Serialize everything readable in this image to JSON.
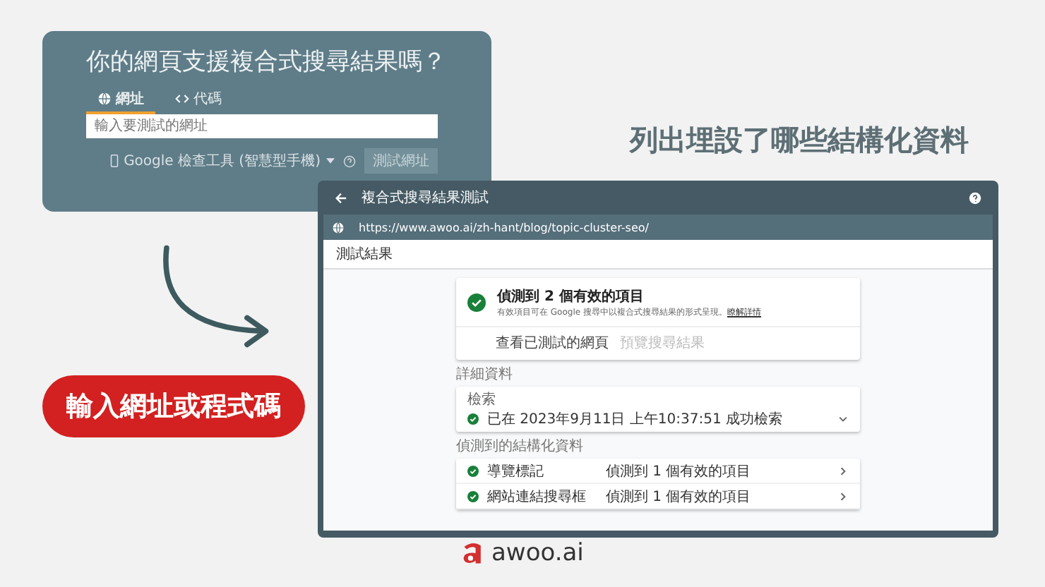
{
  "search_card": {
    "title": "你的網頁支援複合式搜尋結果嗎？",
    "tabs": [
      {
        "label": "網址",
        "kind": "url",
        "selected": true
      },
      {
        "label": "代碼",
        "kind": "code",
        "selected": false
      }
    ],
    "url_field": {
      "placeholder": "輸入要測試的網址"
    },
    "device_select": "Google 檢查工具 (智慧型手機)",
    "test_button": "測試網址"
  },
  "heading": "列出埋設了哪些結構化資料",
  "callout": "輸入網址或程式碼",
  "results_window": {
    "title": "複合式搜尋結果測試",
    "url": "https://www.awoo.ai/zh-hant/blog/topic-cluster-seo/",
    "section_title": "測試結果",
    "summary": {
      "title": "偵測到 2 個有效的項目",
      "description": "有效項目可在 Google 搜尋中以複合式搜尋結果的形式呈現。",
      "link": "瞭解詳情",
      "actions": [
        {
          "label": "查看已測試的網頁",
          "disabled": false
        },
        {
          "label": "預覽搜尋結果",
          "disabled": true
        }
      ]
    },
    "details_label": "詳細資料",
    "crawl": {
      "label": "檢索",
      "status": "已在 2023年9月11日 上午10:37:51 成功檢索"
    },
    "structured_label": "偵測到的結構化資料",
    "items": [
      {
        "name": "導覽標記",
        "status": "偵測到 1 個有效的項目"
      },
      {
        "name": "網站連結搜尋框",
        "status": "偵測到 1 個有效的項目"
      }
    ]
  },
  "logo": {
    "text": "awoo.ai"
  }
}
